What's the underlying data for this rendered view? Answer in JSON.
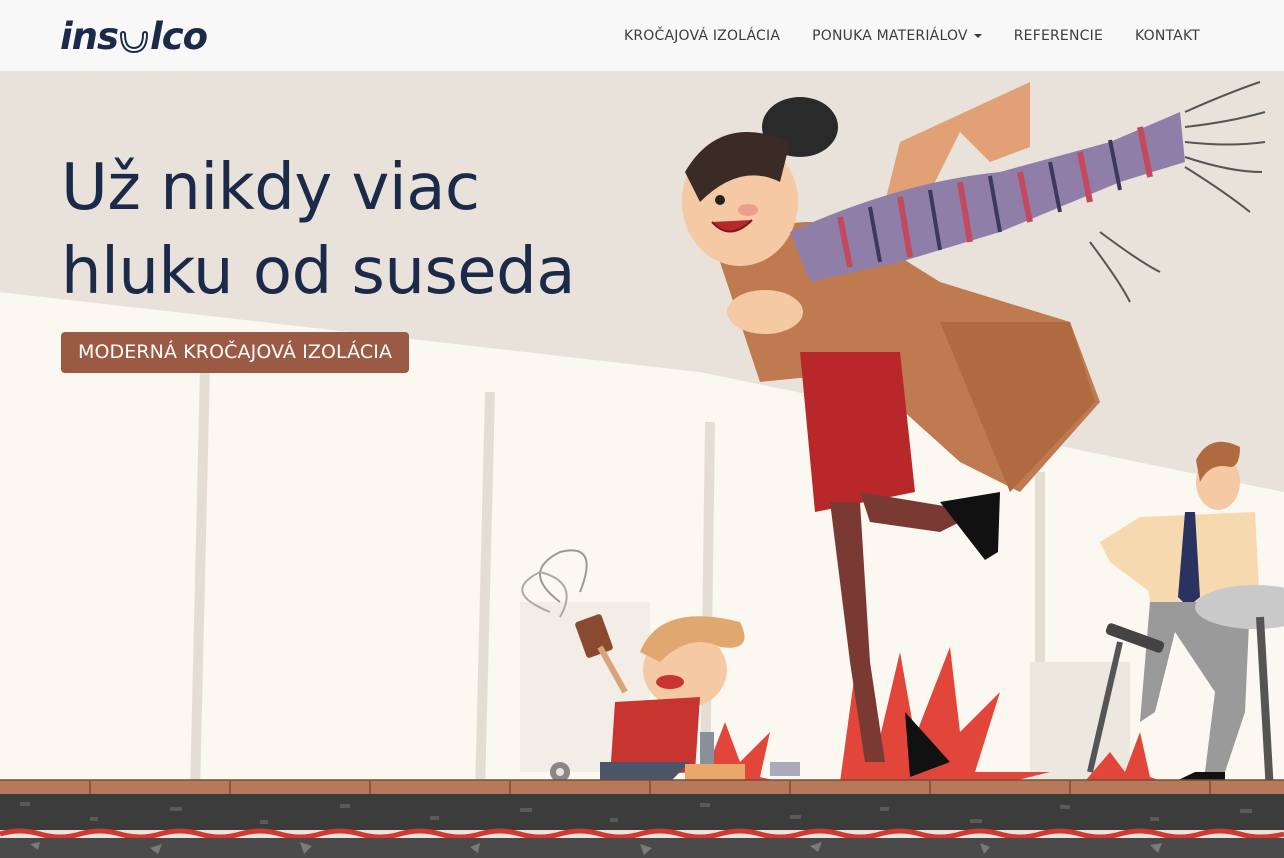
{
  "brand": {
    "logo_left": "ins",
    "logo_right": "lco",
    "accent": "#9a5a44",
    "navy": "#1c2a4a"
  },
  "nav": {
    "items": [
      {
        "label": "KROČAJOVÁ IZOLÁCIA"
      },
      {
        "label": "PONUKA MATERIÁLOV",
        "dropdown": true
      },
      {
        "label": "REFERENCIE"
      },
      {
        "label": "KONTAKT"
      }
    ]
  },
  "hero": {
    "headline_line1": "Už nikdy viac",
    "headline_line2": "hluku od suseda",
    "cta_label": "MODERNÁ KROČAJOVÁ IZOLÁCIA"
  }
}
